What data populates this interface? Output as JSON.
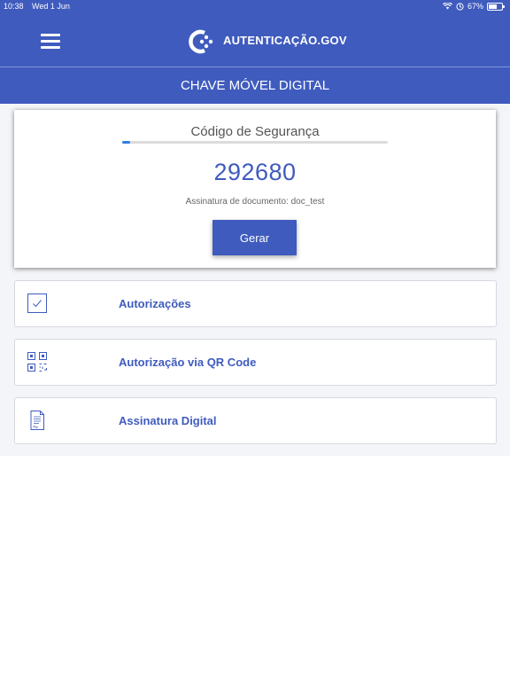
{
  "status_bar": {
    "time": "10:38",
    "date": "Wed 1 Jun",
    "battery": "67%",
    "battery_level": 0.67
  },
  "header": {
    "brand": "AUTENTICAÇÃO.GOV",
    "subtitle": "CHAVE MÓVEL DIGITAL",
    "brand_color": "#3f5bbe",
    "menu_icon": "hamburger-menu-icon"
  },
  "security_card": {
    "title": "Código de Segurança",
    "progress": 0.03,
    "code": "292680",
    "document_line": "Assinatura de documento: doc_test",
    "button_label": "Gerar"
  },
  "options": [
    {
      "label": "Autorizações",
      "icon": "checkbox-icon"
    },
    {
      "label": "Autorização via QR Code",
      "icon": "qr-code-icon"
    },
    {
      "label": "Assinatura Digital",
      "icon": "document-signature-icon"
    }
  ]
}
